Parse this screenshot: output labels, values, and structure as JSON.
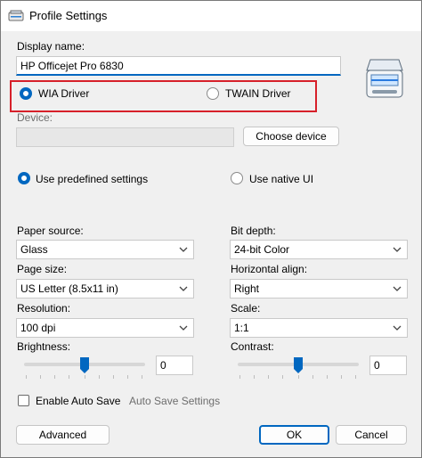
{
  "window": {
    "title": "Profile Settings"
  },
  "display_name": {
    "label": "Display name:",
    "value": "HP Officejet Pro 6830"
  },
  "driver": {
    "wia_label": "WIA Driver",
    "twain_label": "TWAIN Driver",
    "selected": "wia",
    "highlight_color": "#d7202a"
  },
  "device": {
    "label": "Device:",
    "value": "",
    "choose_button": "Choose device"
  },
  "mode": {
    "predefined_label": "Use predefined settings",
    "native_label": "Use native UI",
    "selected": "predefined"
  },
  "left": {
    "paper_source": {
      "label": "Paper source:",
      "value": "Glass"
    },
    "page_size": {
      "label": "Page size:",
      "value": "US Letter (8.5x11 in)"
    },
    "resolution": {
      "label": "Resolution:",
      "value": "100 dpi"
    },
    "brightness": {
      "label": "Brightness:",
      "value": "0",
      "level_percent": 50
    }
  },
  "right": {
    "bit_depth": {
      "label": "Bit depth:",
      "value": "24-bit Color"
    },
    "horizontal_align": {
      "label": "Horizontal align:",
      "value": "Right"
    },
    "scale": {
      "label": "Scale:",
      "value": "1:1"
    },
    "contrast": {
      "label": "Contrast:",
      "value": "0",
      "level_percent": 50
    }
  },
  "autosave": {
    "checkbox_label": "Enable Auto Save",
    "checked": false,
    "settings_link": "Auto Save Settings"
  },
  "buttons": {
    "advanced": "Advanced",
    "ok": "OK",
    "cancel": "Cancel"
  },
  "icons": {
    "app": "scanner-app-icon",
    "scanner": "scanner-icon",
    "dropdown": "chevron-down-icon",
    "slider_thumb": "slider-thumb-icon"
  },
  "colors": {
    "accent": "#0067c0",
    "background": "#f0f0f0"
  }
}
